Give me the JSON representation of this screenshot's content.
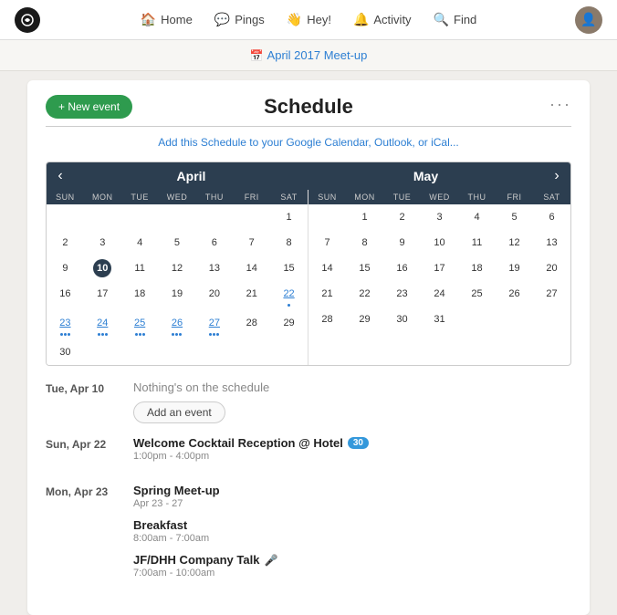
{
  "nav": {
    "logo_text": "~",
    "items": [
      {
        "label": "Home",
        "icon": "🏠"
      },
      {
        "label": "Pings",
        "icon": "💬"
      },
      {
        "label": "Hey!",
        "icon": "👋"
      },
      {
        "label": "Activity",
        "icon": "🔔"
      },
      {
        "label": "Find",
        "icon": "🔍"
      }
    ],
    "avatar_text": "👤"
  },
  "breadcrumb": {
    "icon": "📅",
    "text": "April 2017 Meet-up"
  },
  "more_options": "···",
  "page_title": "Schedule",
  "new_event_label": "+ New event",
  "google_cal_link": "Add this Schedule to your Google Calendar, Outlook, or iCal...",
  "april": {
    "month_label": "April",
    "day_headers": [
      "SUN",
      "MON",
      "TUE",
      "WED",
      "THU",
      "FRI",
      "SAT"
    ],
    "weeks": [
      [
        null,
        null,
        null,
        null,
        null,
        null,
        1
      ],
      [
        2,
        3,
        4,
        5,
        6,
        7,
        8
      ],
      [
        9,
        10,
        11,
        12,
        13,
        14,
        15
      ],
      [
        16,
        17,
        18,
        19,
        20,
        21,
        22
      ],
      [
        23,
        24,
        25,
        26,
        27,
        28,
        29
      ],
      [
        30,
        null,
        null,
        null,
        null,
        null,
        null
      ]
    ],
    "today": 10,
    "event_days": [
      22,
      23,
      24,
      25,
      26,
      27
    ]
  },
  "may": {
    "month_label": "May",
    "day_headers": [
      "SUN",
      "MON",
      "TUE",
      "WED",
      "THU",
      "FRI",
      "SAT"
    ],
    "weeks": [
      [
        null,
        1,
        2,
        3,
        4,
        5,
        6
      ],
      [
        7,
        8,
        9,
        10,
        11,
        12,
        13
      ],
      [
        14,
        15,
        16,
        17,
        18,
        19,
        20
      ],
      [
        21,
        22,
        23,
        24,
        25,
        26,
        27
      ],
      [
        28,
        29,
        30,
        31,
        null,
        null,
        null
      ]
    ],
    "event_days": []
  },
  "schedule": {
    "entries": [
      {
        "date": "Tue, Apr 10",
        "nothing_text": "Nothing's on the schedule",
        "add_event_label": "Add an event",
        "events": []
      },
      {
        "date": "Sun, Apr 22",
        "nothing_text": null,
        "events": [
          {
            "title": "Welcome Cocktail Reception @ Hotel",
            "time": "1:00pm - 4:00pm",
            "badge": "30",
            "emoji": null
          }
        ]
      },
      {
        "date": "Mon, Apr 23",
        "nothing_text": null,
        "events": [
          {
            "title": "Spring Meet-up",
            "subtitle": "Apr 23 - 27",
            "time": null,
            "badge": null,
            "emoji": null
          },
          {
            "title": "Breakfast",
            "time": "8:00am - 7:00am",
            "badge": null,
            "emoji": null
          },
          {
            "title": "JF/DHH Company Talk",
            "time": "7:00am - 10:00am",
            "badge": null,
            "emoji": "🎤"
          }
        ]
      }
    ]
  }
}
